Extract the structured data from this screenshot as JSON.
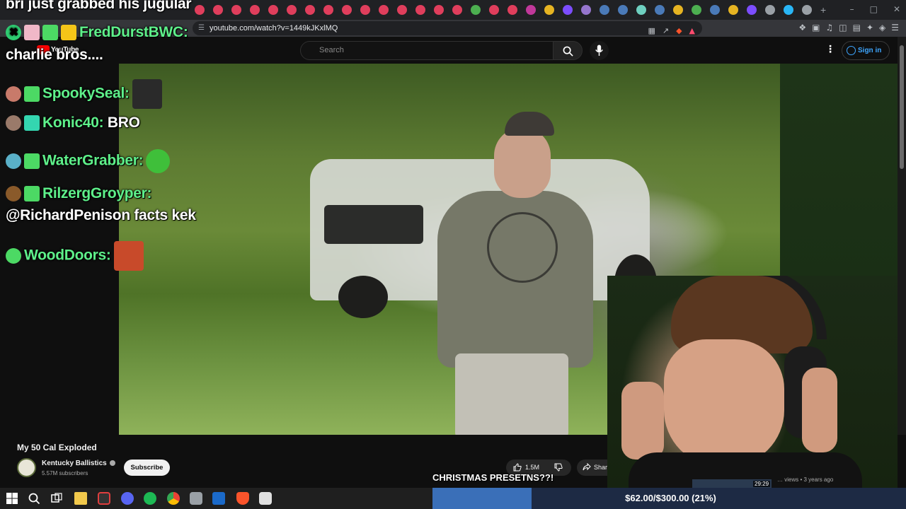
{
  "browser": {
    "url": "youtube.com/watch?v=1449kJKxlMQ",
    "tab_favicon_colors": [
      "#e03e5c",
      "#e03e5c",
      "#e03e5c",
      "#e03e5c",
      "#e03e5c",
      "#e03e5c",
      "#e03e5c",
      "#e03e5c",
      "#e03e5c",
      "#e03e5c",
      "#e03e5c",
      "#e03e5c",
      "#e03e5c",
      "#e03e5c",
      "#e03e5c",
      "#4caf50",
      "#e03e5c",
      "#e03e5c",
      "#c0389a",
      "#e6b422",
      "#7c4dff",
      "#9575cd",
      "#4a7ab8",
      "#4a7ab8",
      "#6ed0c0",
      "#4a7ab8",
      "#e6b422",
      "#4caf50",
      "#4a7ab8",
      "#e6b422",
      "#7c4dff",
      "#9aa0a6",
      "#29b6f6",
      "#9aa0a6"
    ]
  },
  "youtube": {
    "logo_text": "YouTube",
    "search_placeholder": "Search",
    "sign_in": "Sign in"
  },
  "chat": {
    "top_line": "bri just grabbed his jugular",
    "messages": [
      {
        "user": "FredDurstBWC:",
        "text": "",
        "continuation": "charlie bros...."
      },
      {
        "user": "SpookySeal:",
        "text": "",
        "continuation": ""
      },
      {
        "user": "Konic40:",
        "text": "BRO",
        "continuation": ""
      },
      {
        "user": "WaterGrabber:",
        "text": "",
        "continuation": ""
      },
      {
        "user": "RilzergGroyper:",
        "text": "",
        "continuation": "@RichardPenison facts kek"
      },
      {
        "user": "WoodDoors:",
        "text": "",
        "continuation": ""
      }
    ]
  },
  "video": {
    "title": "My 50 Cal Exploded",
    "channel": "Kentucky Ballistics",
    "subscribers": "5.57M subscribers",
    "subscribe_label": "Subscribe",
    "likes": "1.5M",
    "share_label": "Share",
    "mini_duration": "29:29",
    "mini_meta": "… views • 3 years ago"
  },
  "overlay": {
    "caption": "CHRISTMAS PRESETNS??!",
    "goal_text": "$62.00/$300.00 (21%)",
    "goal_fraction": 0.21
  }
}
